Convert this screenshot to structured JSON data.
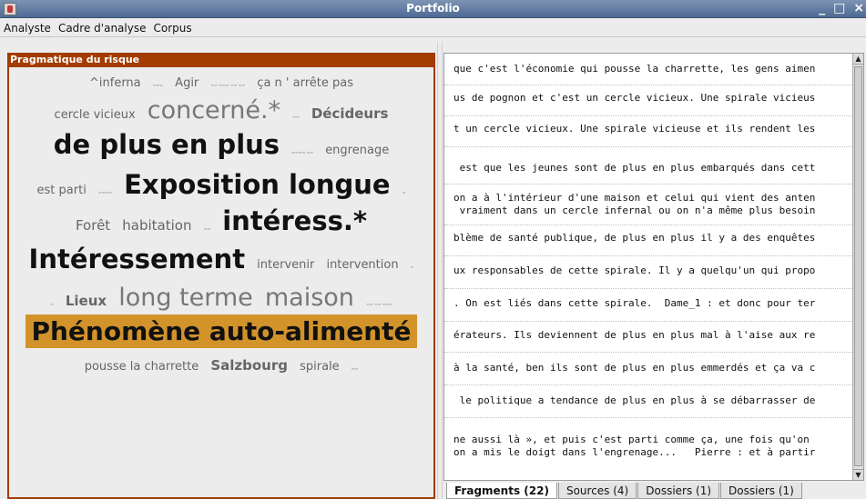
{
  "window": {
    "title": "Portfolio",
    "controls": "_ □ ×"
  },
  "menu": [
    "Analyste",
    "Cadre d'analyse",
    "Corpus"
  ],
  "left_panel": {
    "header": "Pragmatique du risque",
    "cloud": {
      "w1": "^inferna",
      "w2": "Agir",
      "w3": "ça n ' arrête pas",
      "w4": "cercle vicieux",
      "w5": "concerné.*",
      "w6": "Décideurs",
      "w7": "de plus en plus",
      "w8": "engrenage",
      "w9": "est parti",
      "w10": "Exposition longue",
      "w11": "Forêt",
      "w12": "habitation",
      "w13": "intéress.*",
      "w14": "Intéressement",
      "w15": "intervenir",
      "w16": "intervention",
      "w17": "Lieux",
      "w18": "long terme",
      "w19": "maison",
      "w20": "Phénomène auto-alimenté",
      "w21": "pousse la charrette",
      "w22": "Salzbourg",
      "w23": "spirale"
    }
  },
  "fragments": [
    "que c'est l'économie qui pousse la charrette, les gens aimen",
    "us de pognon et c'est un cercle vicieux. Une spirale vicieus",
    "t un cercle vicieux. Une spirale vicieuse et ils rendent les",
    " est que les jeunes sont de plus en plus embarqués dans cett",
    "on a à l'intérieur d'une maison et celui qui vient des anten",
    " vraiment dans un cercle infernal ou on n'a même plus besoin",
    "blème de santé publique, de plus en plus il y a des enquêtes",
    "ux responsables de cette spirale. Il y a quelqu'un qui propo",
    ". On est liés dans cette spirale.  Dame_1 : et donc pour ter",
    "érateurs. Ils deviennent de plus en plus mal à l'aise aux re",
    "à la santé, ben ils sont de plus en plus emmerdés et ça va c",
    " le politique a tendance de plus en plus à se débarrasser de",
    "ne aussi là », et puis c'est parti comme ça, une fois qu'on ",
    "on a mis le doigt dans l'engrenage...   Pierre : et à partir"
  ],
  "tabs": [
    "Fragments (22)",
    "Sources (4)",
    "Dossiers (1)",
    "Dossiers (1)"
  ]
}
